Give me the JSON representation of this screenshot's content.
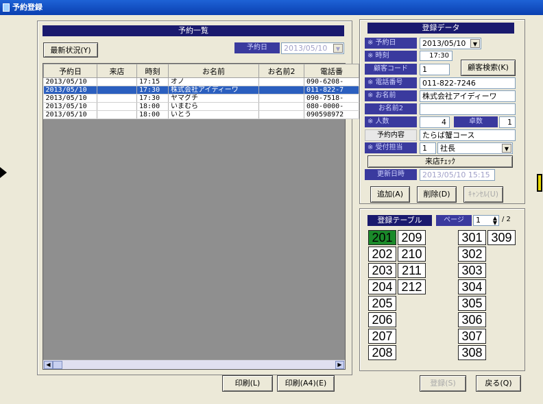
{
  "window": {
    "title": "予約登録"
  },
  "list_panel": {
    "title": "予約一覧",
    "refresh_button": "最新状況(Y)",
    "date_filter_label": "予約日",
    "date_filter_value": "2013/05/10",
    "columns": [
      "予約日",
      "来店",
      "時刻",
      "お名前",
      "お名前2",
      "電話番"
    ],
    "rows": [
      [
        "2013/05/10",
        "",
        "17:15",
        "オノ",
        "",
        "090-6208-"
      ],
      [
        "2013/05/10",
        "",
        "17:30",
        "株式会社アイディーワ",
        "",
        "011-822-7"
      ],
      [
        "2013/05/10",
        "",
        "17:30",
        "ヤマグチ",
        "",
        "090-7518-"
      ],
      [
        "2013/05/10",
        "",
        "18:00",
        "いまむら",
        "",
        "080-0000-"
      ],
      [
        "2013/05/10",
        "",
        "18:00",
        "いとう",
        "",
        "090598972"
      ]
    ],
    "selected_row": 1
  },
  "bottom_buttons": {
    "print": "印刷(L)",
    "print_a4": "印刷(A4)(E)",
    "register": "登録(S)",
    "back": "戻る(Q)"
  },
  "form_panel": {
    "title": "登録データ",
    "date_label": "※ 予約日",
    "date_value": "2013/05/10",
    "time_label": "※ 時刻",
    "time_value": "17:30",
    "customer_code_label": "顧客コード",
    "customer_code_value": "1",
    "customer_search_button": "顧客検索(K)",
    "phone_label": "※ 電話番号",
    "phone_value": "011-822-7246",
    "name_label": "※ お名前",
    "name_value": "株式会社アイディーワ",
    "name2_label": "お名前2",
    "name2_value": "",
    "people_label": "※ 人数",
    "people_value": "4",
    "tables_label": "卓数",
    "tables_value": "1",
    "content_label": "予約内容",
    "content_value": "たらば蟹コース",
    "staff_label": "※ 受付担当",
    "staff_code": "1",
    "staff_name": "社長",
    "visit_check_button": "来店ﾁｪｯｸ",
    "updated_label": "更新日時",
    "updated_value": "2013/05/10 15:15",
    "add_button": "追加(A)",
    "delete_button": "削除(D)",
    "cancel_button": "ｷｬﾝｾﾙ(U)"
  },
  "table_panel": {
    "title": "登録テーブル",
    "page_label": "ページ",
    "page_value": "1",
    "page_total": "/ 2",
    "tables_col1": [
      "201",
      "202",
      "203",
      "204",
      "205",
      "206",
      "207",
      "208"
    ],
    "tables_col2": [
      "209",
      "210",
      "211",
      "212"
    ],
    "tables_col3": [
      "301",
      "302",
      "303",
      "304",
      "305",
      "306",
      "307",
      "308"
    ],
    "tables_col4": [
      "309"
    ],
    "occupied": [
      "201"
    ]
  },
  "colors": {
    "title_bar": "#0a3fb0",
    "selection": "#2b5fbf",
    "occupied_table": "#1a8a2a",
    "panel_header": "#1a1a6e"
  }
}
